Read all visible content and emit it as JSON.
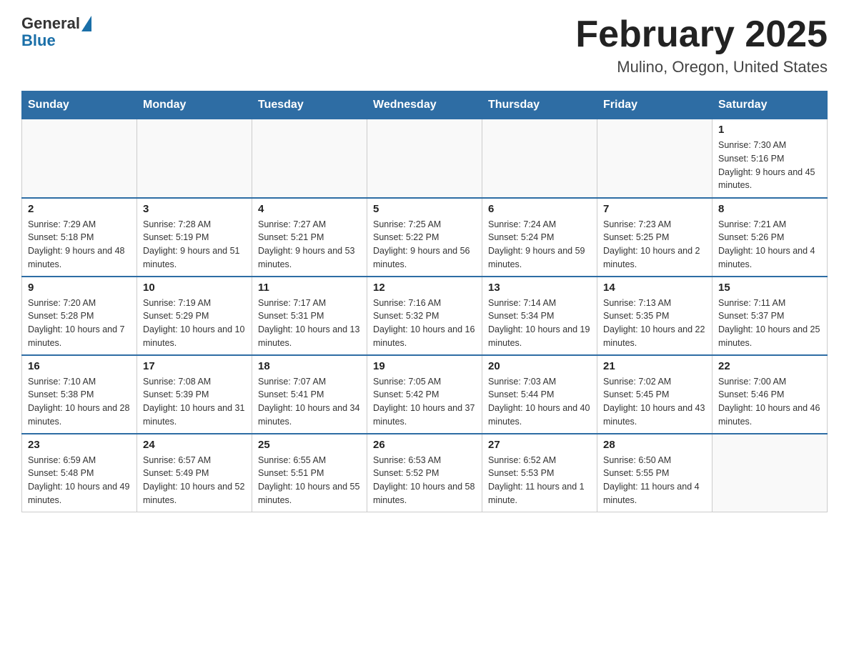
{
  "header": {
    "logo_general": "General",
    "logo_blue": "Blue",
    "title": "February 2025",
    "location": "Mulino, Oregon, United States"
  },
  "days_of_week": [
    "Sunday",
    "Monday",
    "Tuesday",
    "Wednesday",
    "Thursday",
    "Friday",
    "Saturday"
  ],
  "weeks": [
    [
      {
        "day": "",
        "info": ""
      },
      {
        "day": "",
        "info": ""
      },
      {
        "day": "",
        "info": ""
      },
      {
        "day": "",
        "info": ""
      },
      {
        "day": "",
        "info": ""
      },
      {
        "day": "",
        "info": ""
      },
      {
        "day": "1",
        "info": "Sunrise: 7:30 AM\nSunset: 5:16 PM\nDaylight: 9 hours and 45 minutes."
      }
    ],
    [
      {
        "day": "2",
        "info": "Sunrise: 7:29 AM\nSunset: 5:18 PM\nDaylight: 9 hours and 48 minutes."
      },
      {
        "day": "3",
        "info": "Sunrise: 7:28 AM\nSunset: 5:19 PM\nDaylight: 9 hours and 51 minutes."
      },
      {
        "day": "4",
        "info": "Sunrise: 7:27 AM\nSunset: 5:21 PM\nDaylight: 9 hours and 53 minutes."
      },
      {
        "day": "5",
        "info": "Sunrise: 7:25 AM\nSunset: 5:22 PM\nDaylight: 9 hours and 56 minutes."
      },
      {
        "day": "6",
        "info": "Sunrise: 7:24 AM\nSunset: 5:24 PM\nDaylight: 9 hours and 59 minutes."
      },
      {
        "day": "7",
        "info": "Sunrise: 7:23 AM\nSunset: 5:25 PM\nDaylight: 10 hours and 2 minutes."
      },
      {
        "day": "8",
        "info": "Sunrise: 7:21 AM\nSunset: 5:26 PM\nDaylight: 10 hours and 4 minutes."
      }
    ],
    [
      {
        "day": "9",
        "info": "Sunrise: 7:20 AM\nSunset: 5:28 PM\nDaylight: 10 hours and 7 minutes."
      },
      {
        "day": "10",
        "info": "Sunrise: 7:19 AM\nSunset: 5:29 PM\nDaylight: 10 hours and 10 minutes."
      },
      {
        "day": "11",
        "info": "Sunrise: 7:17 AM\nSunset: 5:31 PM\nDaylight: 10 hours and 13 minutes."
      },
      {
        "day": "12",
        "info": "Sunrise: 7:16 AM\nSunset: 5:32 PM\nDaylight: 10 hours and 16 minutes."
      },
      {
        "day": "13",
        "info": "Sunrise: 7:14 AM\nSunset: 5:34 PM\nDaylight: 10 hours and 19 minutes."
      },
      {
        "day": "14",
        "info": "Sunrise: 7:13 AM\nSunset: 5:35 PM\nDaylight: 10 hours and 22 minutes."
      },
      {
        "day": "15",
        "info": "Sunrise: 7:11 AM\nSunset: 5:37 PM\nDaylight: 10 hours and 25 minutes."
      }
    ],
    [
      {
        "day": "16",
        "info": "Sunrise: 7:10 AM\nSunset: 5:38 PM\nDaylight: 10 hours and 28 minutes."
      },
      {
        "day": "17",
        "info": "Sunrise: 7:08 AM\nSunset: 5:39 PM\nDaylight: 10 hours and 31 minutes."
      },
      {
        "day": "18",
        "info": "Sunrise: 7:07 AM\nSunset: 5:41 PM\nDaylight: 10 hours and 34 minutes."
      },
      {
        "day": "19",
        "info": "Sunrise: 7:05 AM\nSunset: 5:42 PM\nDaylight: 10 hours and 37 minutes."
      },
      {
        "day": "20",
        "info": "Sunrise: 7:03 AM\nSunset: 5:44 PM\nDaylight: 10 hours and 40 minutes."
      },
      {
        "day": "21",
        "info": "Sunrise: 7:02 AM\nSunset: 5:45 PM\nDaylight: 10 hours and 43 minutes."
      },
      {
        "day": "22",
        "info": "Sunrise: 7:00 AM\nSunset: 5:46 PM\nDaylight: 10 hours and 46 minutes."
      }
    ],
    [
      {
        "day": "23",
        "info": "Sunrise: 6:59 AM\nSunset: 5:48 PM\nDaylight: 10 hours and 49 minutes."
      },
      {
        "day": "24",
        "info": "Sunrise: 6:57 AM\nSunset: 5:49 PM\nDaylight: 10 hours and 52 minutes."
      },
      {
        "day": "25",
        "info": "Sunrise: 6:55 AM\nSunset: 5:51 PM\nDaylight: 10 hours and 55 minutes."
      },
      {
        "day": "26",
        "info": "Sunrise: 6:53 AM\nSunset: 5:52 PM\nDaylight: 10 hours and 58 minutes."
      },
      {
        "day": "27",
        "info": "Sunrise: 6:52 AM\nSunset: 5:53 PM\nDaylight: 11 hours and 1 minute."
      },
      {
        "day": "28",
        "info": "Sunrise: 6:50 AM\nSunset: 5:55 PM\nDaylight: 11 hours and 4 minutes."
      },
      {
        "day": "",
        "info": ""
      }
    ]
  ]
}
